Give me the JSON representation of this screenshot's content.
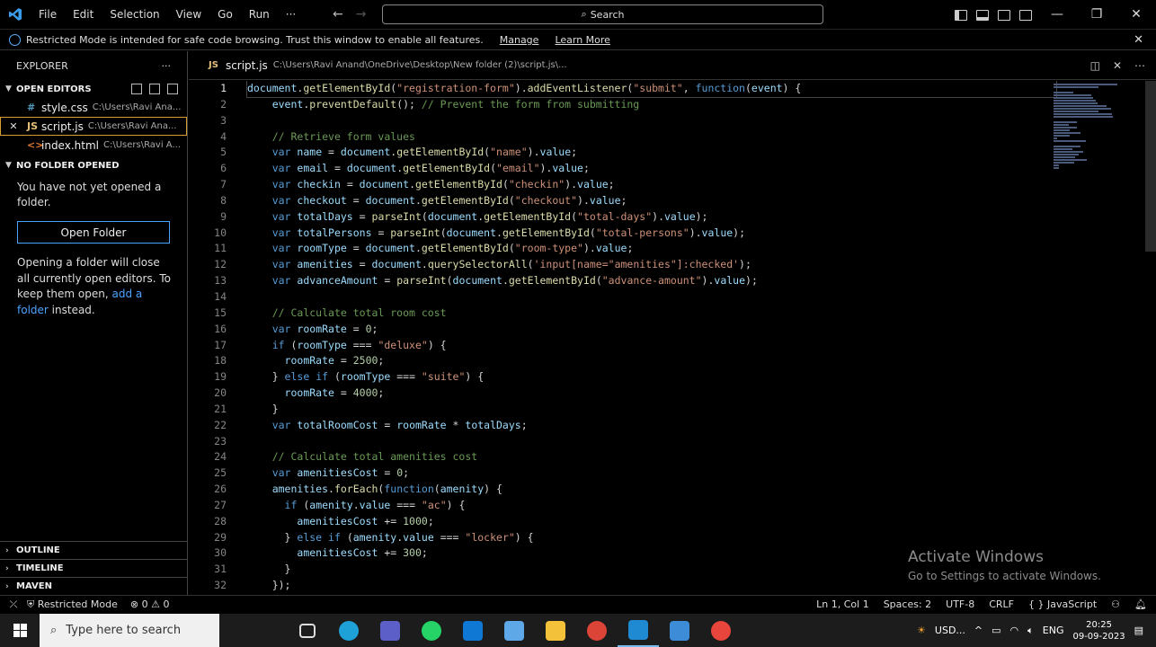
{
  "titlebar": {
    "menu": [
      "File",
      "Edit",
      "Selection",
      "View",
      "Go",
      "Run",
      "···"
    ],
    "search_label": "Search"
  },
  "banner": {
    "message": "Restricted Mode is intended for safe code browsing. Trust this window to enable all features.",
    "manage": "Manage",
    "learn_more": "Learn More"
  },
  "sidebar": {
    "title": "EXPLORER",
    "more": "···",
    "open_editors_title": "OPEN EDITORS",
    "open_editors": [
      {
        "icon": "#",
        "icon_color": "#519aba",
        "name": "style.css",
        "path": "C:\\Users\\Ravi Ana..."
      },
      {
        "icon": "JS",
        "icon_color": "#e5c07b",
        "name": "script.js",
        "path": "C:\\Users\\Ravi Ana..."
      },
      {
        "icon": "<>",
        "icon_color": "#e37933",
        "name": "index.html",
        "path": "C:\\Users\\Ravi A..."
      }
    ],
    "no_folder_title": "NO FOLDER OPENED",
    "no_folder_msg": "You have not yet opened a folder.",
    "open_folder_button": "Open Folder",
    "info_before": "Opening a folder will close all currently open editors. To keep them open,",
    "info_link": "add a folder",
    "info_after": "instead.",
    "outline": "OUTLINE",
    "timeline": "TIMELINE",
    "maven": "MAVEN"
  },
  "tab": {
    "icon": "JS",
    "name": "script.js",
    "path": "C:\\Users\\Ravi Anand\\OneDrive\\Desktop\\New folder (2)\\script.js\\..."
  },
  "editor": {
    "line_numbers": [
      "1",
      "2",
      "3",
      "4",
      "5",
      "6",
      "7",
      "8",
      "9",
      "10",
      "11",
      "12",
      "13",
      "14",
      "15",
      "16",
      "17",
      "18",
      "19",
      "20",
      "21",
      "22",
      "23",
      "24",
      "25",
      "26",
      "27",
      "28",
      "29",
      "30",
      "31",
      "32"
    ],
    "lines": [
      "document.getElementById(\"registration-form\").addEventListener(\"submit\", function(event) {",
      "    event.preventDefault(); // Prevent the form from submitting",
      "",
      "    // Retrieve form values",
      "    var name = document.getElementById(\"name\").value;",
      "    var email = document.getElementById(\"email\").value;",
      "    var checkin = document.getElementById(\"checkin\").value;",
      "    var checkout = document.getElementById(\"checkout\").value;",
      "    var totalDays = parseInt(document.getElementById(\"total-days\").value);",
      "    var totalPersons = parseInt(document.getElementById(\"total-persons\").value);",
      "    var roomType = document.getElementById(\"room-type\").value;",
      "    var amenities = document.querySelectorAll('input[name=\"amenities\"]:checked');",
      "    var advanceAmount = parseInt(document.getElementById(\"advance-amount\").value);",
      "",
      "    // Calculate total room cost",
      "    var roomRate = 0;",
      "    if (roomType === \"deluxe\") {",
      "      roomRate = 2500;",
      "    } else if (roomType === \"suite\") {",
      "      roomRate = 4000;",
      "    }",
      "    var totalRoomCost = roomRate * totalDays;",
      "",
      "    // Calculate total amenities cost",
      "    var amenitiesCost = 0;",
      "    amenities.forEach(function(amenity) {",
      "      if (amenity.value === \"ac\") {",
      "        amenitiesCost += 1000;",
      "      } else if (amenity.value === \"locker\") {",
      "        amenitiesCost += 300;",
      "      }",
      "    });"
    ]
  },
  "watermark": {
    "title": "Activate Windows",
    "subtitle": "Go to Settings to activate Windows."
  },
  "statusbar": {
    "restricted": "Restricted Mode",
    "problems": "⊗ 0 ⚠ 0",
    "position": "Ln 1, Col 1",
    "spaces": "Spaces: 2",
    "encoding": "UTF-8",
    "eol": "CRLF",
    "language": "{ } JavaScript"
  },
  "taskbar": {
    "search_placeholder": "Type here to search",
    "weather": "USD...",
    "lang": "ENG",
    "time": "20:25",
    "date": "09-09-2023"
  },
  "colors": {
    "keyword": "#569cd6",
    "string": "#ce9178",
    "comment": "#6a9955",
    "number": "#b5cea8",
    "function": "#dcdcaa",
    "variable": "#9cdcfe",
    "accent": "#4aa3ff"
  }
}
